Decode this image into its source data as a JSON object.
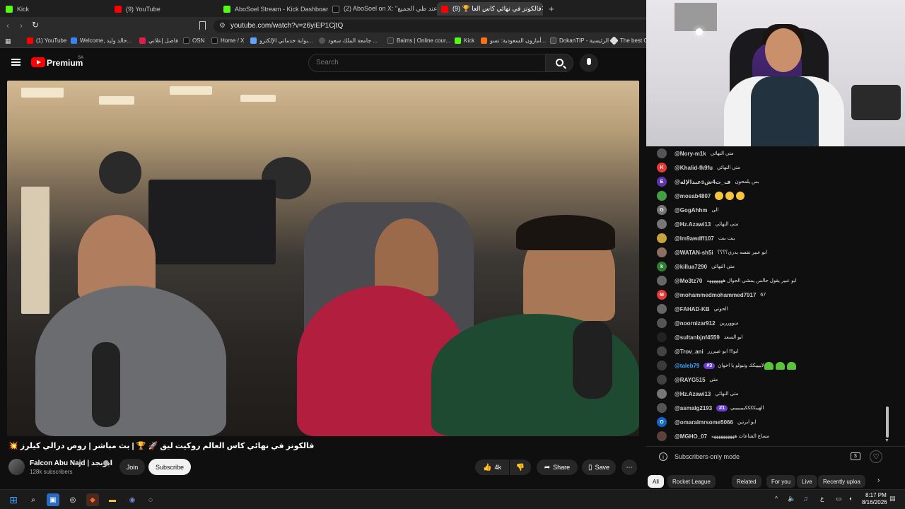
{
  "browser": {
    "tabs": [
      {
        "label": "Kick",
        "color": "#53fc18"
      },
      {
        "label": "(9) YouTube",
        "color": "#ff0000"
      },
      {
        "label": "AboSoel Stream - Kick Dashboard",
        "color": "#53fc18"
      },
      {
        "label": "(2) AboSoel on X: \"نه وعند ظي الجميع",
        "color": "#111111"
      },
      {
        "label": "(9) 🏆 فالكونز في نهائي كاس العا",
        "color": "#ff0000"
      }
    ],
    "url": "youtube.com/watch?v=z6yiEP1CjtQ",
    "bookmarks": [
      {
        "label": "(1) YouTube",
        "color": "#ff0000"
      },
      {
        "label": "Welcome, خالد وليد...",
        "color": "#3b82f6"
      },
      {
        "label": "فاصل إعلاني",
        "color": "#e11d48"
      },
      {
        "label": "OSN",
        "color": "#111111"
      },
      {
        "label": "Home / X",
        "color": "#111111"
      },
      {
        "label": "بوابة خدماتي الإلكترو...",
        "color": "#60a5fa"
      },
      {
        "label": "جامعة الملك سعود ...",
        "color": "#555555"
      },
      {
        "label": "Baims | Online cour...",
        "color": "#333333"
      },
      {
        "label": "Kick",
        "color": "#53fc18"
      },
      {
        "label": "أمازون السعودية: تسو...",
        "color": "#f97316"
      },
      {
        "label": "DokanTIP - الرئيسية",
        "color": "#444444"
      },
      {
        "label": "The best Cl",
        "color": "#dddddd"
      }
    ]
  },
  "youtube": {
    "brand": "Premium",
    "region": "SA",
    "search_placeholder": "Search"
  },
  "video": {
    "title": "فالكونز في نهائي كاس العالم روكيت ليق 🚀 🏆 | بث مباشر | روص درالي كيلرز 💥",
    "channel_name": "Falcon Abu Najd | ابونجد",
    "subscribers": "128k subscribers",
    "join_label": "Join",
    "subscribe_label": "Subscribe",
    "likes": "4k",
    "share_label": "Share",
    "save_label": "Save"
  },
  "chat": {
    "messages": [
      {
        "author": "@Nory-m1k",
        "text": "متى النهائي",
        "avatar_color": "#555555",
        "initial": ""
      },
      {
        "author": "@Khalid-fk9fu",
        "text": "متى النهائي",
        "avatar_color": "#e53935",
        "initial": "K"
      },
      {
        "author": "@عبدالإلهsف_ت4ش",
        "text": "بس يلمحون",
        "avatar_color": "#5e35b1",
        "initial": "E"
      },
      {
        "author": "@mosab4807",
        "text": "",
        "avatar_color": "#43a047",
        "initial": "",
        "emoji": "faces"
      },
      {
        "author": "@GogAhhm",
        "text": "الى",
        "avatar_color": "#757575",
        "initial": "G"
      },
      {
        "author": "@Hz.Azawi13",
        "text": "متى النهائي",
        "avatar_color": "#777777",
        "initial": ""
      },
      {
        "author": "@lm9awdff107",
        "text": "بنت بنت",
        "avatar_color": "#c8a23a",
        "initial": ""
      },
      {
        "author": "@WATAN-sh5i",
        "text": "ابو عبير نفسه يدري؟؟؟؟",
        "avatar_color": "#8d6e63",
        "initial": ""
      },
      {
        "author": "@killua7290",
        "text": "متى النهائي",
        "avatar_color": "#2e7d32",
        "initial": "k"
      },
      {
        "author": "@Mo3tz70",
        "text": "ابو عبير يقول جالس يمشي الجوال هههههههه",
        "avatar_color": "#666666",
        "initial": ""
      },
      {
        "author": "@mohammedmohammed7917",
        "text": "67",
        "avatar_color": "#e53935",
        "initial": "M"
      },
      {
        "author": "@FAHAD-KB",
        "text": "الحوتي",
        "avatar_color": "#666666",
        "initial": ""
      },
      {
        "author": "@noornizar912",
        "text": "منووررين",
        "avatar_color": "#555555",
        "initial": ""
      },
      {
        "author": "@sultanbjnf4559",
        "text": "ابو السعد",
        "avatar_color": "#222222",
        "initial": ""
      },
      {
        "author": "@Trov_ani",
        "text": "ابو!!! ابو عبيررر",
        "avatar_color": "#444444",
        "initial": ""
      },
      {
        "author": "@taleb79",
        "text": "لاييييكك وتبولو يا اخوان",
        "badge": "#3",
        "avatar_color": "#3a3a3a",
        "initial": "",
        "emoji": "hearts",
        "highlight": true
      },
      {
        "author": "@RAYG515",
        "text": "متى",
        "avatar_color": "#424242",
        "initial": ""
      },
      {
        "author": "@Hz.Azawi13",
        "text": "متى النهائي",
        "avatar_color": "#777777",
        "initial": ""
      },
      {
        "author": "@asmalg2193",
        "text": "الهيبككككيييييييي",
        "badge": "#1",
        "avatar_color": "#555555",
        "initial": ""
      },
      {
        "author": "@omaralmrsome5066",
        "text": "ابو ابرتين",
        "avatar_color": "#1565c0",
        "initial": "O"
      },
      {
        "author": "@MGHO_07",
        "text": "مساع الشاعات ههههههههههه",
        "avatar_color": "#5d4037",
        "initial": ""
      }
    ],
    "footer_text": "Subscribers-only mode",
    "chips": [
      "All",
      "Rocket League",
      "Related",
      "For you",
      "Live",
      "Recently uploa"
    ]
  },
  "taskbar": {
    "time": "8:17 PM",
    "date": "8/16/2026",
    "lang": "ع"
  }
}
